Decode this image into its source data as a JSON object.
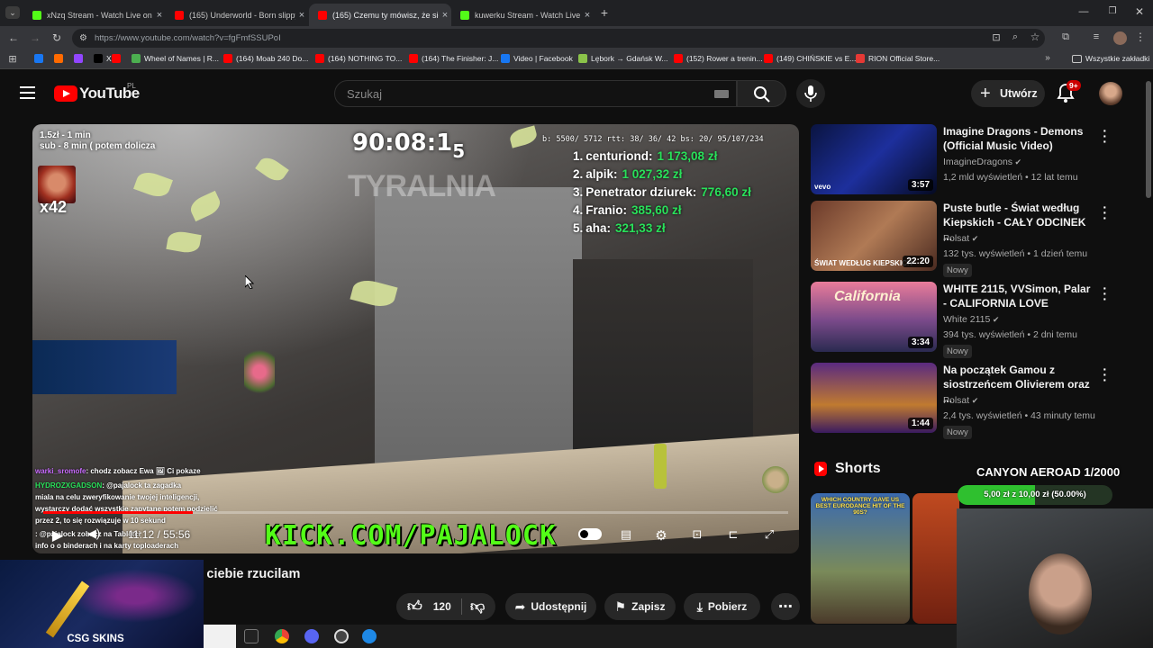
{
  "browser": {
    "tabs": [
      {
        "title": "xNzq Stream - Watch Live on K",
        "color": "#53fc18"
      },
      {
        "title": "(165) Underworld - Born slippy",
        "color": "#ff0000"
      },
      {
        "title": "(165) Czemu ty mówisz, że się r",
        "color": "#ff0000"
      },
      {
        "title": "kuwerku Stream - Watch Live on",
        "color": "#53fc18"
      }
    ],
    "new_tab": "+",
    "url": "https://www.youtube.com/watch?v=fgFmfSSUPoI",
    "bookmarks": [
      {
        "label": "",
        "color": "#1877f2"
      },
      {
        "label": "",
        "color": "#ff6a00"
      },
      {
        "label": "",
        "color": "#9146ff"
      },
      {
        "label": "X",
        "color": "#000000"
      },
      {
        "label": "",
        "color": "#ff0000"
      },
      {
        "label": "Wheel of Names | R...",
        "color": "#4caf50"
      },
      {
        "label": "(164) Moab 240 Do...",
        "color": "#ff0000"
      },
      {
        "label": "(164) NOTHING TO...",
        "color": "#ff0000"
      },
      {
        "label": "(164) The Finisher: J...",
        "color": "#ff0000"
      },
      {
        "label": "Video | Facebook",
        "color": "#1877f2"
      },
      {
        "label": "Lębork → Gdańsk W...",
        "color": "#8bc34a"
      },
      {
        "label": "(152) Rower a trenin...",
        "color": "#ff0000"
      },
      {
        "label": "(149) CHIŃSKIE vs E...",
        "color": "#ff0000"
      },
      {
        "label": "RION Official Store...",
        "color": "#e53935"
      }
    ],
    "all_bookmarks": "Wszystkie zakładki"
  },
  "youtube": {
    "logo_text": "YouTube",
    "logo_region": "PL",
    "search_placeholder": "Szukaj",
    "create_label": "Utwórz",
    "notif_count": "9+"
  },
  "overlay": {
    "goal1": "1.5zł - 1 min",
    "goal2": "sub - 8 min ( potem dolicza",
    "multiplier": "x42",
    "timer": "90:08:1",
    "timer_sub": "5",
    "watermark": "TYRALNIA",
    "stats": "b: 5500/ 5712 rtt: 38/ 36/ 42 bs: 20/ 95/107/234",
    "leaderboard": [
      {
        "rank": "1.",
        "name": "centuriond:",
        "amount": "1 173,08 zł"
      },
      {
        "rank": "2.",
        "name": "alpik:",
        "amount": "1 027,32 zł"
      },
      {
        "rank": "3.",
        "name": "Penetrator dziurek:",
        "amount": "776,60 zł"
      },
      {
        "rank": "4.",
        "name": "Franio:",
        "amount": "385,60 zł"
      },
      {
        "rank": "5.",
        "name": "aha:",
        "amount": "321,33 zł"
      }
    ],
    "kick_url": "KICK.COM/PAJALOCK",
    "chat": [
      {
        "user": "warki_sromofe",
        "text": ": chodz zobacz Ewa 🖼 Ci pokaze"
      },
      {
        "user": "HYDROZXGADSON",
        "text": ": @pajalock ta zagadka"
      },
      {
        "user": "",
        "text": "miala na celu zweryfikowanie twojej inteligencji,"
      },
      {
        "user": "",
        "text": "wystarczy dodać wszystkie zapytane potem podzielić"
      },
      {
        "user": "",
        "text": "przez 2, to się rozwiązuje w 10 sekund"
      },
      {
        "user": "",
        "text": ": @pajalock zobacz na Tabletci"
      },
      {
        "user": "",
        "text": "info o o binderach i na karty toploaderach"
      }
    ]
  },
  "player": {
    "time": "11:12 / 55:56"
  },
  "video": {
    "title": "Czemu ty mówisz, że się na ciebie rzucilam",
    "likes": "120",
    "share": "Udostępnij",
    "save": "Zapisz",
    "download": "Pobierz"
  },
  "sidebar": {
    "items": [
      {
        "title": "Imagine Dragons - Demons (Official Music Video)",
        "channel": "ImagineDragons",
        "meta": "1,2 mld wyświetleń • 12 lat temu",
        "duration": "3:57",
        "badge": "",
        "thumb_label": "vevo",
        "thumb_bg": "linear-gradient(135deg,#0a1440,#1d2f9c 50%,#050a20)"
      },
      {
        "title": "Puste butle - Świat według Kiepskich - CAŁY ODCINEK ...",
        "channel": "Polsat",
        "meta": "132 tys. wyświetleń • 1 dzień temu",
        "duration": "22:20",
        "badge": "Nowy",
        "thumb_label": "ŚWIAT WEDŁUG KIEPSKICH",
        "thumb_bg": "linear-gradient(135deg,#6b3a2a,#b07a55 50%,#4a2a20)"
      },
      {
        "title": "WHITE 2115, VVSimon, Palar - CALIFORNIA LOVE",
        "channel": "White 2115",
        "meta": "394 tys. wyświetleń • 2 dni temu",
        "duration": "3:34",
        "badge": "Nowy",
        "thumb_label": "California",
        "thumb_bg": "linear-gradient(180deg,#e97c9a,#7a4a8a 55%,#2a2a50)"
      },
      {
        "title": "Na początek Gamou z siostrzeńcem Olivierem oraz ...",
        "channel": "Polsat",
        "meta": "2,4 tys. wyświetleń • 43 minuty temu",
        "duration": "1:44",
        "badge": "Nowy",
        "thumb_label": "",
        "thumb_bg": "linear-gradient(180deg,#5a2a80,#c07a30 60%,#3a1a60)"
      }
    ],
    "shorts_label": "Shorts",
    "short1_text": "WHICH COUNTRY GAVE US BEST EURODANCE HIT OF THE 90S?"
  },
  "stream_overlay": {
    "goal_title": "CANYON AEROAD 1/2000",
    "goal_progress": "5,00 zł z 10,00 zł (50.00%)",
    "goal_fraction": 0.5,
    "brand": "CSG SKINS"
  }
}
